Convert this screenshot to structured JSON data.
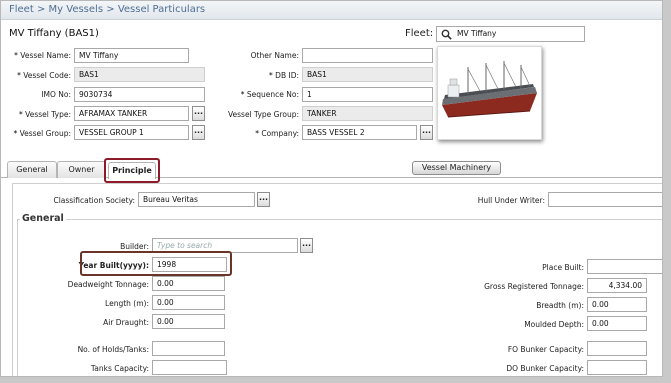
{
  "breadcrumb": {
    "root": "Fleet",
    "sep1": ">",
    "mid": "My Vessels",
    "sep2": ">",
    "current": "Vessel Particulars"
  },
  "header": {
    "title": "MV Tiffany (BAS1)",
    "fleet_label": "Fleet:",
    "fleet_value": "MV Tiffany"
  },
  "particulars": {
    "vessel_name": {
      "label": "Vessel Name:",
      "value": "MV Tiffany"
    },
    "vessel_code": {
      "label": "Vessel Code:",
      "value": "BAS1"
    },
    "imo_no": {
      "label": "IMO No:",
      "value": "9030734"
    },
    "vessel_type": {
      "label": "Vessel Type:",
      "value": "AFRAMAX TANKER"
    },
    "vessel_group": {
      "label": "Vessel Group:",
      "value": "VESSEL GROUP 1"
    },
    "other_name": {
      "label": "Other Name:",
      "value": ""
    },
    "db_id": {
      "label": "DB ID:",
      "value": "BAS1"
    },
    "sequence_no": {
      "label": "Sequence No:",
      "value": "1"
    },
    "vessel_type_group": {
      "label": "Vessel Type Group:",
      "value": "TANKER"
    },
    "company": {
      "label": "Company:",
      "value": "BASS VESSEL 2"
    },
    "required_mark": "*",
    "picker_glyph": "..."
  },
  "tabs": [
    {
      "label": "General"
    },
    {
      "label": "Owner"
    },
    {
      "label": "Principle"
    }
  ],
  "vessel_machinery_button": "Vessel Machinery",
  "principle": {
    "classification_society": {
      "label": "Classification Society:",
      "value": "Bureau Veritas"
    },
    "hull_under_writer": {
      "label": "Hull Under Writer:",
      "value": ""
    },
    "section_title": "General",
    "builder": {
      "label": "Builder:",
      "placeholder": "Type to search"
    },
    "year_built": {
      "label": "Year Built(yyyy):",
      "value": "1998"
    },
    "place_built": {
      "label": "Place Built:",
      "value": ""
    },
    "deadweight_tonnage": {
      "label": "Deadweight Tonnage:",
      "value": "0.00"
    },
    "gross_registered_tonnage": {
      "label": "Gross Registered Tonnage:",
      "value": "4,334.00"
    },
    "length": {
      "label": "Length (m):",
      "value": "0.00"
    },
    "breadth": {
      "label": "Breadth (m):",
      "value": "0.00"
    },
    "air_draught": {
      "label": "Air Draught:",
      "value": "0.00"
    },
    "moulded_depth": {
      "label": "Moulded Depth:",
      "value": "0.00"
    },
    "holds_tanks": {
      "label": "No. of Holds/Tanks:",
      "value": ""
    },
    "fo_bunker_capacity": {
      "label": "FO Bunker Capacity:",
      "value": ""
    },
    "tanks_capacity": {
      "label": "Tanks Capacity:",
      "value": ""
    },
    "do_bunker_capacity": {
      "label": "DO Bunker Capacity:",
      "value": ""
    }
  },
  "colors": {
    "breadcrumb_text": "#4d6f93",
    "tab_highlight": "#8c1c2a",
    "year_highlight": "#6a3528",
    "section_title": "#333333"
  }
}
